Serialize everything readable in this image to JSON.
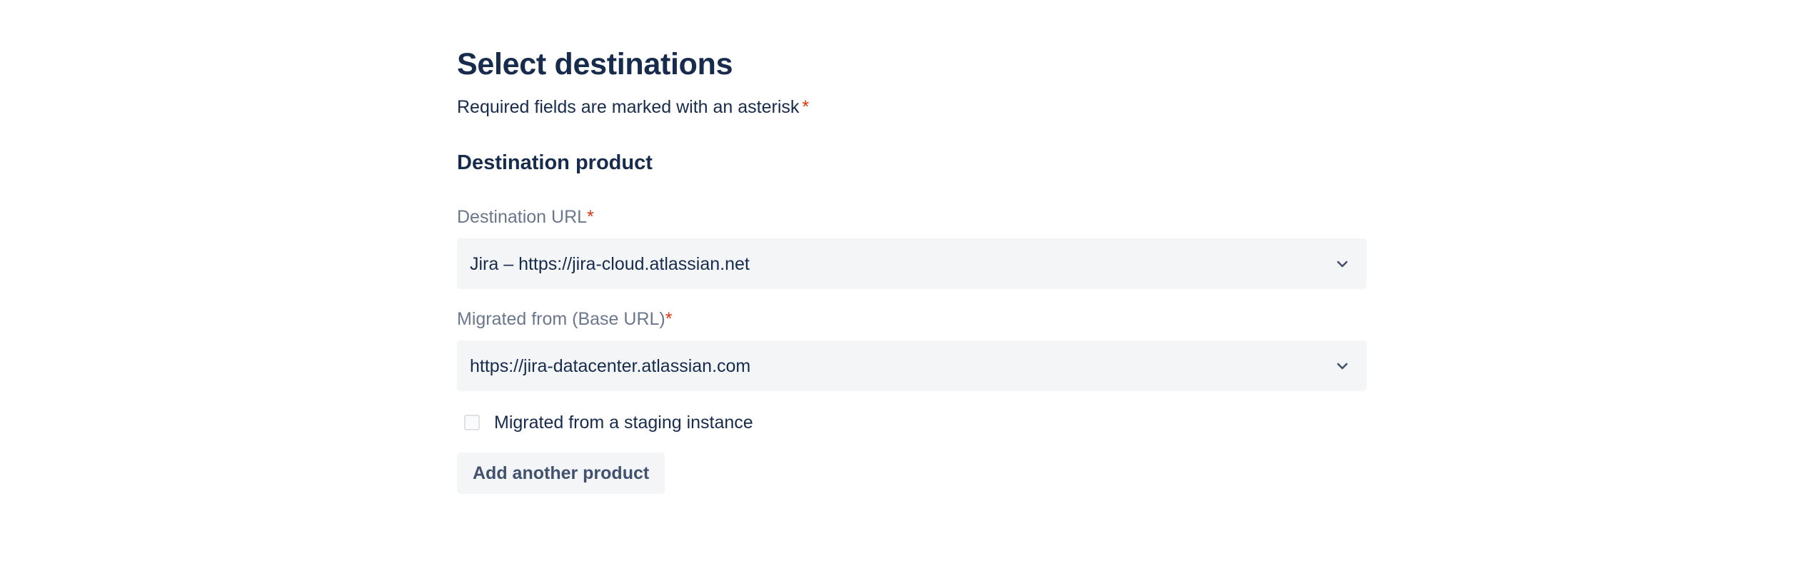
{
  "page": {
    "title": "Select destinations",
    "required_note": "Required fields are marked with an asterisk",
    "required_marker": "*"
  },
  "section": {
    "title": "Destination product"
  },
  "fields": {
    "destination_url": {
      "label": "Destination URL",
      "required_marker": "*",
      "value": "Jira – https://jira-cloud.atlassian.net",
      "icon": "chevron-down-icon"
    },
    "migrated_from": {
      "label": "Migrated from (Base URL)",
      "required_marker": "*",
      "value": "https://jira-datacenter.atlassian.com",
      "icon": "chevron-down-icon"
    }
  },
  "staging_checkbox": {
    "label": "Migrated from a staging instance",
    "checked": false
  },
  "actions": {
    "add_product_label": "Add another product"
  },
  "colors": {
    "text_primary": "#172b4d",
    "text_subtle": "#6b778c",
    "required": "#de350b",
    "field_background": "#f4f5f7",
    "button_text": "#42526e"
  }
}
